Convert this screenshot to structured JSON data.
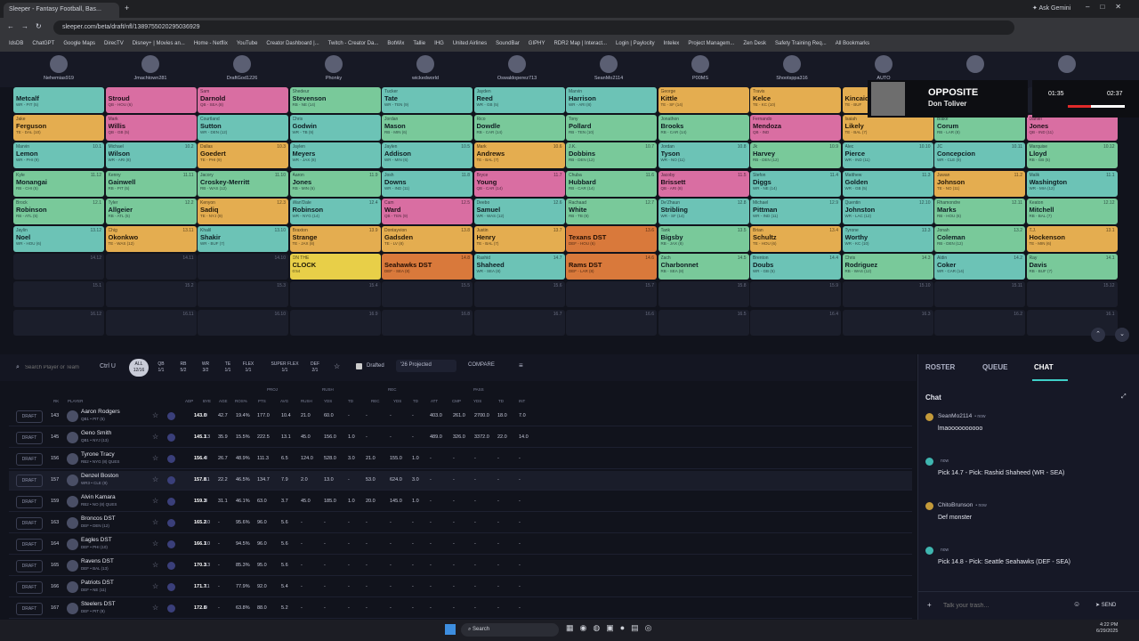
{
  "browser": {
    "tab_title": "Sleeper - Fantasy Football, Bas...",
    "url": "sleeper.com/beta/draft/nfl/1389755020295036929",
    "gemini": "Ask Gemini",
    "bookmarks": [
      "IdsDB",
      "ChatGPT",
      "Google Maps",
      "DirecTV",
      "Disney+ | Movies an...",
      "Home - Netflix",
      "YouTube",
      "Creator Dashboard |...",
      "Twitch - Creator Da...",
      "BotWix",
      "Tallie",
      "IHG",
      "United Airlines",
      "SoundBar",
      "GIPHY",
      "RDR2 Map | Interact...",
      "Login | Paylocity",
      "Intelex",
      "Project Managem...",
      "Zen Desk",
      "Safety Training Req...",
      "All Bookmarks"
    ]
  },
  "teams": [
    "Nehemias919",
    "Jmachtown281",
    "DraftGod1226",
    "Phonky",
    "wickedworld",
    "Oswaldoperez713",
    "SeanMo2114",
    "P00MS",
    "Shootsppa316",
    "AUTO",
    "",
    ""
  ],
  "board": {
    "rows": [
      [
        [
          "",
          "Metcalf",
          "WR - PIT (5)",
          "",
          "wr"
        ],
        [
          "",
          "Stroud",
          "QB - HOU (6)",
          "",
          "qb"
        ],
        [
          "Sam",
          "Darnold",
          "QB - SEA (8)",
          "",
          "qb"
        ],
        [
          "Shedeur",
          "Stevenson",
          "RB - NE (14)",
          "",
          "rb"
        ],
        [
          "Tucker",
          "Tate",
          "WR - TEN (9)",
          "",
          "wr"
        ],
        [
          "Jayden",
          "Reed",
          "WR - GB (5)",
          "",
          "wr"
        ],
        [
          "Marvin",
          "Harrison",
          "WR - ARI (8)",
          "",
          "wr"
        ],
        [
          "George",
          "Kittle",
          "TE - SF (14)",
          "",
          "te"
        ],
        [
          "Travis",
          "Kelce",
          "TE - KC (10)",
          "",
          "te"
        ],
        [
          "",
          "Kincaid",
          "TE - BUF",
          "",
          "te"
        ],
        [
          "",
          "",
          "",
          "",
          ""
        ],
        [
          "",
          "",
          "",
          "",
          ""
        ]
      ],
      [
        [
          "Jake",
          "Ferguson",
          "TE - DAL (10)",
          "",
          "te"
        ],
        [
          "Mark",
          "Willis",
          "QB - GB (5)",
          "",
          "qb"
        ],
        [
          "Courtland",
          "Sutton",
          "WR - DEN (12)",
          "",
          "wr"
        ],
        [
          "Chris",
          "Godwin",
          "WR - TB (9)",
          "",
          "wr"
        ],
        [
          "Jordan",
          "Mason",
          "RB - MIN (6)",
          "",
          "rb"
        ],
        [
          "Rico",
          "Dowdle",
          "RB - CAR (14)",
          "",
          "rb"
        ],
        [
          "Tony",
          "Pollard",
          "RB - TEN (10)",
          "",
          "rb"
        ],
        [
          "Jonathon",
          "Brooks",
          "RB - CAR (14)",
          "",
          "rb"
        ],
        [
          "Fernando",
          "Mendoza",
          "QB - IND",
          "",
          "qb"
        ],
        [
          "Isaiah",
          "Likely",
          "TE - BAL (7)",
          "",
          "te"
        ],
        [
          "Blake",
          "Corum",
          "RB - LAR (8)",
          "",
          "rb"
        ],
        [
          "Daniel",
          "Jones",
          "QB - IND (11)",
          "",
          "qb"
        ]
      ],
      [
        [
          "Marvin",
          "Lemon",
          "WR - PHI (9)",
          "10.1",
          "wr"
        ],
        [
          "Michael",
          "Wilson",
          "WR - ARI (8)",
          "10.2",
          "wr"
        ],
        [
          "Dallas",
          "Goedert",
          "TE - PHI (9)",
          "10.3",
          "te"
        ],
        [
          "Jaylen",
          "Meyers",
          "WR - JAX (8)",
          "",
          "wr"
        ],
        [
          "Jaylen",
          "Addison",
          "WR - MIN (6)",
          "10.5",
          "wr"
        ],
        [
          "Mark",
          "Andrews",
          "TE - BAL (7)",
          "10.6",
          "te"
        ],
        [
          "J.K.",
          "Dobbins",
          "RB - DEN (12)",
          "10.7",
          "rb"
        ],
        [
          "Jordan",
          "Tyson",
          "WR - NO (11)",
          "10.8",
          "wr"
        ],
        [
          "Jk",
          "Harvey",
          "RB - DEN (12)",
          "10.9",
          "rb"
        ],
        [
          "Alec",
          "Pierce",
          "WR - IND (11)",
          "10.10",
          "wr"
        ],
        [
          "JC",
          "Concepcion",
          "WR - CLE (9)",
          "10.11",
          "wr"
        ],
        [
          "Marquise",
          "Lloyd",
          "RB - GB (5)",
          "10.12",
          "rb"
        ]
      ],
      [
        [
          "Kyle",
          "Monangai",
          "RB - CHI (5)",
          "11.12",
          "rb"
        ],
        [
          "Kenny",
          "Gainwell",
          "RB - PIT (5)",
          "11.11",
          "rb"
        ],
        [
          "Jacory",
          "Croskey-Merritt",
          "RB - WAS (12)",
          "11.10",
          "rb"
        ],
        [
          "Aaron",
          "Jones",
          "RB - MIN (6)",
          "11.9",
          "rb"
        ],
        [
          "Josh",
          "Downs",
          "WR - IND (11)",
          "11.8",
          "wr"
        ],
        [
          "Bryce",
          "Young",
          "QB - CAR (14)",
          "11.7",
          "qb"
        ],
        [
          "Chuba",
          "Hubbard",
          "RB - CAR (14)",
          "11.6",
          "rb"
        ],
        [
          "Jacoby",
          "Brissett",
          "QB - ARI (8)",
          "11.5",
          "qb"
        ],
        [
          "Stefon",
          "Diggs",
          "WR - NE (14)",
          "11.4",
          "wr"
        ],
        [
          "Matthew",
          "Golden",
          "WR - GB (5)",
          "11.3",
          "wr"
        ],
        [
          "Juwan",
          "Johnson",
          "TE - NO (11)",
          "11.2",
          "te"
        ],
        [
          "Malik",
          "Washington",
          "WR - MIA (12)",
          "11.1",
          "wr"
        ]
      ],
      [
        [
          "Brock",
          "Robinson",
          "RB - ATL (5)",
          "12.1",
          "rb"
        ],
        [
          "Tyler",
          "Allgeier",
          "RB - ATL (5)",
          "12.2",
          "rb"
        ],
        [
          "Kenyon",
          "Sadiq",
          "TE - NYJ (9)",
          "12.3",
          "te"
        ],
        [
          "Wan'Dale",
          "Robinson",
          "WR - NYG (14)",
          "12.4",
          "wr"
        ],
        [
          "Cam",
          "Ward",
          "QB - TEN (9)",
          "12.5",
          "qb"
        ],
        [
          "Deebo",
          "Samuel",
          "WR - WAS (12)",
          "12.6",
          "wr"
        ],
        [
          "Rachaad",
          "White",
          "RB - TB (9)",
          "12.7",
          "rb"
        ],
        [
          "De'Zhaun",
          "Stribling",
          "WR - SF (14)",
          "12.8",
          "wr"
        ],
        [
          "Michael",
          "Pittman",
          "WR - IND (11)",
          "12.9",
          "wr"
        ],
        [
          "Quentin",
          "Johnston",
          "WR - LAC (12)",
          "12.10",
          "wr"
        ],
        [
          "Rhamondre",
          "Marks",
          "RB - HOU (6)",
          "12.11",
          "rb"
        ],
        [
          "Keaton",
          "Mitchell",
          "RB - BAL (7)",
          "12.12",
          "rb"
        ]
      ],
      [
        [
          "Jaylin",
          "Noel",
          "WR - HOU (6)",
          "13.12",
          "wr"
        ],
        [
          "Chig",
          "Okonkwo",
          "TE - WAS (12)",
          "13.11",
          "te"
        ],
        [
          "Khalil",
          "Shakir",
          "WR - BUF (7)",
          "13.10",
          "wr"
        ],
        [
          "Braxton",
          "Strange",
          "TE - JAX (8)",
          "13.9",
          "te"
        ],
        [
          "Dontayvion",
          "Gadsden",
          "TE - LV (8)",
          "13.8",
          "te"
        ],
        [
          "Justin",
          "Henry",
          "TE - BAL (7)",
          "13.7",
          "te"
        ],
        [
          "",
          "Texans DST",
          "DEF - HOU (6)",
          "13.6",
          "def"
        ],
        [
          "Tank",
          "Bigsby",
          "RB - JAX (8)",
          "13.5",
          "rb"
        ],
        [
          "Brian",
          "Schultz",
          "TE - HOU (6)",
          "13.4",
          "te"
        ],
        [
          "Tyrone",
          "Worthy",
          "WR - KC (10)",
          "13.3",
          "wr"
        ],
        [
          "Jonah",
          "Coleman",
          "RB - DEN (12)",
          "13.2",
          "rb"
        ],
        [
          "T.J.",
          "Hockenson",
          "TE - MIN (6)",
          "13.1",
          "te"
        ]
      ],
      [
        [
          "",
          "",
          "",
          "14.12",
          "empty"
        ],
        [
          "",
          "",
          "",
          "14.11",
          "empty"
        ],
        [
          "",
          "",
          "",
          "14.10",
          "empty"
        ],
        [
          "ON THE",
          "CLOCK",
          "0:54",
          "",
          "clock"
        ],
        [
          "",
          "Seahawks DST",
          "DEF - SEA (8)",
          "14.8",
          "def"
        ],
        [
          "Rashid",
          "Shaheed",
          "WR - SEA (8)",
          "14.7",
          "wr"
        ],
        [
          "",
          "Rams DST",
          "DEF - LAR (8)",
          "14.6",
          "def"
        ],
        [
          "Zach",
          "Charbonnet",
          "RB - SEA (8)",
          "14.5",
          "rb"
        ],
        [
          "Brenton",
          "Doubs",
          "WR - GB (5)",
          "14.4",
          "wr"
        ],
        [
          "Chris",
          "Rodriguez",
          "RB - WAS (12)",
          "14.3",
          "rb"
        ],
        [
          "Aldin",
          "Coker",
          "WR - CAR (14)",
          "14.2",
          "wr"
        ],
        [
          "Ray",
          "Davis",
          "RB - BUF (7)",
          "14.1",
          "rb"
        ]
      ],
      [
        [
          "",
          "",
          "",
          "15.1",
          "empty"
        ],
        [
          "",
          "",
          "",
          "15.2",
          "empty"
        ],
        [
          "",
          "",
          "",
          "15.3",
          "empty"
        ],
        [
          "",
          "",
          "",
          "15.4",
          "empty"
        ],
        [
          "",
          "",
          "",
          "15.5",
          "empty"
        ],
        [
          "",
          "",
          "",
          "15.6",
          "empty"
        ],
        [
          "",
          "",
          "",
          "15.7",
          "empty"
        ],
        [
          "",
          "",
          "",
          "15.8",
          "empty"
        ],
        [
          "",
          "",
          "",
          "15.9",
          "empty"
        ],
        [
          "",
          "",
          "",
          "15.10",
          "empty"
        ],
        [
          "",
          "",
          "",
          "15.11",
          "empty"
        ],
        [
          "",
          "",
          "",
          "15.12",
          "empty"
        ]
      ],
      [
        [
          "",
          "",
          "",
          "16.12",
          "empty"
        ],
        [
          "",
          "",
          "",
          "16.11",
          "empty"
        ],
        [
          "",
          "",
          "",
          "16.10",
          "empty"
        ],
        [
          "",
          "",
          "",
          "16.9",
          "empty"
        ],
        [
          "",
          "",
          "",
          "16.8",
          "empty"
        ],
        [
          "",
          "",
          "",
          "16.7",
          "empty"
        ],
        [
          "",
          "",
          "",
          "16.6",
          "empty"
        ],
        [
          "",
          "",
          "",
          "16.5",
          "empty"
        ],
        [
          "",
          "",
          "",
          "16.4",
          "empty"
        ],
        [
          "",
          "",
          "",
          "16.3",
          "empty"
        ],
        [
          "",
          "",
          "",
          "16.2",
          "empty"
        ],
        [
          "",
          "",
          "",
          "16.1",
          "empty"
        ]
      ]
    ]
  },
  "opposite": {
    "title": "OPPOSITE",
    "artist": "Don Toliver",
    "time_left": "01:35",
    "time_right": "02:37"
  },
  "toolbar": {
    "search_placeholder": "Search Player or Team",
    "shortcut": "Ctrl U",
    "filters": [
      [
        "ALL",
        "12/16"
      ],
      [
        "QB",
        "1/1"
      ],
      [
        "RB",
        "5/2"
      ],
      [
        "WR",
        "3/2"
      ],
      [
        "TE",
        "1/1"
      ],
      [
        "FLEX",
        "1/1"
      ],
      [
        "SUPER FLEX",
        "1/1"
      ],
      [
        "DEF",
        "2/1"
      ]
    ],
    "drafted": "Drafted",
    "projected": "'26 Projected",
    "compare": "COMPARE"
  },
  "table": {
    "group_headers": [
      "PROJ",
      "RUSH",
      "REC",
      "PASS"
    ],
    "headers": [
      "RK",
      "PLAYER",
      "ADP",
      "BYE",
      "AGE",
      "ROS%",
      "PTS",
      "AVG",
      "RUSH",
      "YDS",
      "TD",
      "REC",
      "YDS",
      "TD",
      "ATT",
      "CMP",
      "YDS",
      "TD",
      "INT"
    ],
    "draft_label": "DRAFT",
    "rows": [
      [
        "143",
        "Aaron Rodgers",
        "QB1 • PIT (5)",
        "143.0",
        "9",
        "42.7",
        "19.4%",
        "177.0",
        "10.4",
        "21.0",
        "60.0",
        "-",
        "-",
        "-",
        "-",
        "403.0",
        "261.0",
        "2700.0",
        "18.0",
        "7.0"
      ],
      [
        "145",
        "Geno Smith",
        "QB1 • NYJ (13)",
        "145.1",
        "13",
        "35.9",
        "15.5%",
        "222.5",
        "13.1",
        "45.0",
        "156.0",
        "1.0",
        "-",
        "-",
        "-",
        "489.0",
        "326.0",
        "3372.0",
        "22.0",
        "14.0"
      ],
      [
        "156",
        "Tyrone Tracy",
        "RB2 • NYG (8) QUES",
        "156.4",
        "8",
        "26.7",
        "48.9%",
        "111.3",
        "6.5",
        "124.0",
        "528.0",
        "3.0",
        "21.0",
        "155.0",
        "1.0",
        "-",
        "-",
        "-",
        "-",
        "-"
      ],
      [
        "157",
        "Denzel Boston",
        "WR3 • CLE (9)",
        "157.8",
        "11",
        "22.2",
        "46.5%",
        "134.7",
        "7.9",
        "2.0",
        "13.0",
        "-",
        "53.0",
        "624.0",
        "3.0",
        "-",
        "-",
        "-",
        "-",
        "-"
      ],
      [
        "159",
        "Alvin Kamara",
        "RB2 • NO (8) QUES",
        "159.3",
        "8",
        "31.1",
        "46.1%",
        "63.0",
        "3.7",
        "45.0",
        "185.0",
        "1.0",
        "20.0",
        "145.0",
        "1.0",
        "-",
        "-",
        "-",
        "-",
        "-"
      ],
      [
        "163",
        "Broncos DST",
        "DEF • DEN (12)",
        "165.2",
        "10",
        "-",
        "95.6%",
        "96.0",
        "5.6",
        "-",
        "-",
        "-",
        "-",
        "-",
        "-",
        "-",
        "-",
        "-",
        "-",
        "-"
      ],
      [
        "164",
        "Eagles DST",
        "DEF • PHI (10)",
        "166.1",
        "10",
        "-",
        "94.5%",
        "96.0",
        "5.6",
        "-",
        "-",
        "-",
        "-",
        "-",
        "-",
        "-",
        "-",
        "-",
        "-",
        "-"
      ],
      [
        "165",
        "Ravens DST",
        "DEF • BAL (13)",
        "170.3",
        "13",
        "-",
        "85.3%",
        "95.0",
        "5.6",
        "-",
        "-",
        "-",
        "-",
        "-",
        "-",
        "-",
        "-",
        "-",
        "-",
        "-"
      ],
      [
        "166",
        "Patriots DST",
        "DEF • NE (11)",
        "171.7",
        "11",
        "-",
        "77.9%",
        "92.0",
        "5.4",
        "-",
        "-",
        "-",
        "-",
        "-",
        "-",
        "-",
        "-",
        "-",
        "-",
        "-"
      ],
      [
        "167",
        "Steelers DST",
        "DEF • PIT (9)",
        "172.8",
        "9",
        "-",
        "63.8%",
        "88.0",
        "5.2",
        "-",
        "-",
        "-",
        "-",
        "-",
        "-",
        "-",
        "-",
        "-",
        "-",
        "-"
      ]
    ]
  },
  "side": {
    "tabs": [
      "ROSTER",
      "QUEUE",
      "CHAT"
    ],
    "chat_title": "Chat",
    "messages": [
      {
        "user": "SeanMo2114",
        "time": "• now",
        "text": "lmaoooooooooo"
      },
      {
        "user": "",
        "time": "now",
        "text": "Pick 14.7 - Pick: Rashid Shaheed (WR - SEA)"
      },
      {
        "user": "ChitoBrunson",
        "time": "• now",
        "text": "Def monster"
      },
      {
        "user": "",
        "time": "now",
        "text": "Pick 14.8 - Pick: Seattle Seahawks (DEF - SEA)"
      }
    ],
    "input_placeholder": "Talk your trash...",
    "send": "SEND"
  },
  "taskbar": {
    "search": "Search",
    "time": "4:22 PM",
    "date": "6/29/2025"
  }
}
